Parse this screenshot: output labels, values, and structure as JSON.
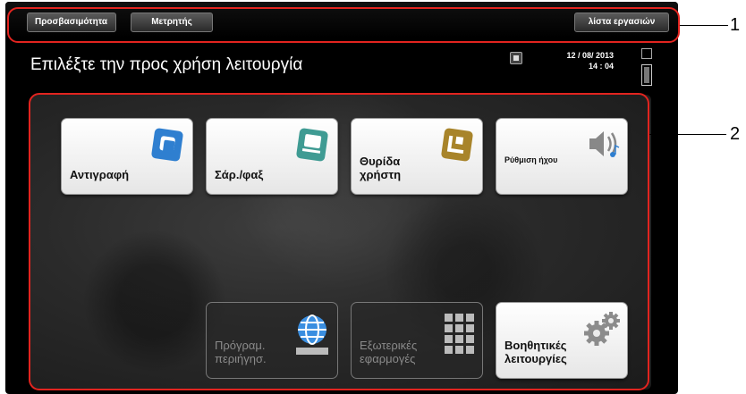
{
  "topbar": {
    "accessibility_label": "Προσβασιμότητα",
    "counter_label": "Μετρητής",
    "job_list_label": "λίστα εργασιών"
  },
  "titlebar": {
    "title": "Επιλέξτε την προς χρήση λειτουργία",
    "date": "12 / 08/ 2013",
    "time": "14 : 04"
  },
  "tiles": {
    "copy": "Αντιγραφή",
    "scan_fax": "Σάρ./φαξ",
    "user_box": "Θυρίδα\nχρήστη",
    "sound": "Ρύθμιση ήχου",
    "browser": "Πρόγραμ.\nπεριήγησ.",
    "external_apps": "Εξωτερικές\nεφαρμογές",
    "utility": "Βοηθητικές\nλειτουργίες"
  },
  "callouts": {
    "one": "1",
    "two": "2"
  },
  "colors": {
    "callout_red": "#e2241f",
    "copy_blue": "#2f7fd0",
    "scan_teal": "#3f9b93",
    "box_gold": "#a8842a"
  }
}
